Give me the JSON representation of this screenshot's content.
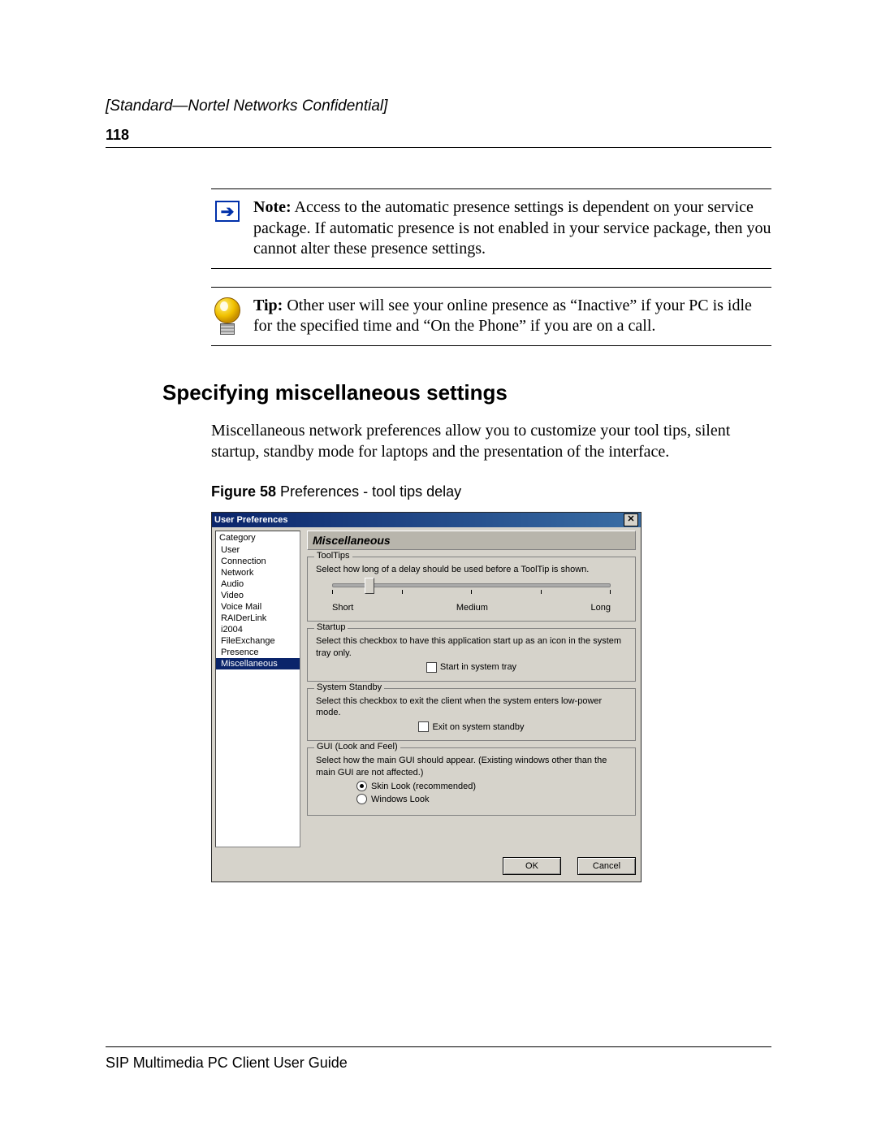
{
  "header": "[Standard—Nortel Networks Confidential]",
  "page_number": "118",
  "note_label": "Note:",
  "note_text": " Access to the automatic presence settings is dependent on your service package. If automatic presence is not enabled in your service package, then you cannot alter these presence settings.",
  "tip_label": "Tip:",
  "tip_text": " Other user will see your online presence as “Inactive” if your PC is idle for the specified time and “On the Phone” if you are on a call.",
  "section_heading": "Specifying miscellaneous settings",
  "body_paragraph": "Miscellaneous network preferences allow you to customize your tool tips, silent startup, standby mode for laptops and the presentation of the interface.",
  "figure_label": "Figure 58",
  "figure_caption": "   Preferences - tool tips delay",
  "dialog": {
    "title": "User Preferences",
    "tree_header": "Category",
    "tree": [
      "User",
      "Connection",
      "Network",
      "Audio",
      "Video",
      "Voice Mail",
      "RAIDerLink",
      "i2004",
      "FileExchange",
      "Presence",
      "Miscellaneous"
    ],
    "selected_index": 10,
    "panel_title": "Miscellaneous",
    "tooltips": {
      "legend": "ToolTips",
      "text": "Select how long of a delay should be used before a ToolTip is shown.",
      "short": "Short",
      "medium": "Medium",
      "long": "Long"
    },
    "startup": {
      "legend": "Startup",
      "text": "Select this checkbox to have this application start up as an icon in the system tray only.",
      "checkbox": "Start in system tray"
    },
    "standby": {
      "legend": "System Standby",
      "text": "Select this checkbox to exit the client when the system enters low-power mode.",
      "checkbox": "Exit on system standby"
    },
    "gui": {
      "legend": "GUI (Look and Feel)",
      "text": "Select how the main GUI should appear. (Existing windows other than the main GUI are not affected.)",
      "option1": "Skin Look (recommended)",
      "option2": "Windows Look"
    },
    "ok": "OK",
    "cancel": "Cancel"
  },
  "footer": "SIP Multimedia PC Client User Guide"
}
